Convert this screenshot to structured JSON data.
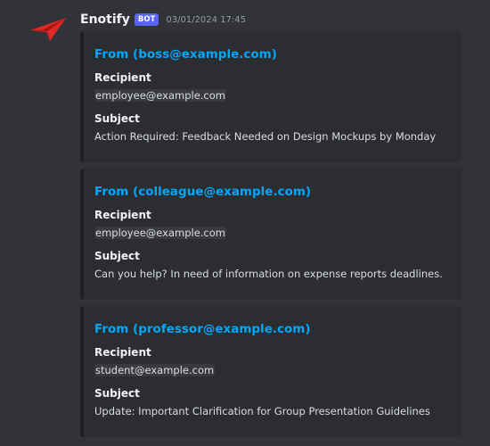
{
  "author": {
    "name": "Enotify",
    "badge": "BOT",
    "timestamp": "03/01/2024 17:45",
    "avatar_icon": "paper-plane-icon",
    "avatar_color": "#e02828"
  },
  "embeds": [
    {
      "title": "From (boss@example.com)",
      "recipient_label": "Recipient",
      "recipient": "employee@example.com",
      "subject_label": "Subject",
      "subject": "Action Required: Feedback Needed on Design Mockups by Monday"
    },
    {
      "title": "From (colleague@example.com)",
      "recipient_label": "Recipient",
      "recipient": "employee@example.com",
      "subject_label": "Subject",
      "subject": "Can you help? In need of information on expense reports deadlines."
    },
    {
      "title": "From (professor@example.com)",
      "recipient_label": "Recipient",
      "recipient": "student@example.com",
      "subject_label": "Subject",
      "subject": "Update: Important Clarification for Group Presentation Guidelines"
    }
  ],
  "colors": {
    "background": "#313338",
    "embed_background": "#2b2d31",
    "title_link": "#00a8fc",
    "badge": "#5865f2"
  }
}
